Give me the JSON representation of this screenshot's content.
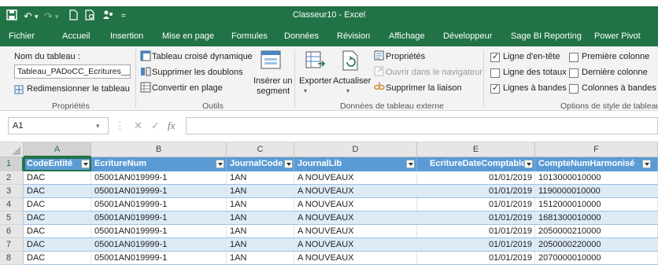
{
  "titlebar": {
    "title": "Classeur10 - Excel"
  },
  "tabs": [
    {
      "label": "Fichier"
    },
    {
      "label": "Accueil"
    },
    {
      "label": "Insertion"
    },
    {
      "label": "Mise en page"
    },
    {
      "label": "Formules"
    },
    {
      "label": "Données"
    },
    {
      "label": "Révision"
    },
    {
      "label": "Affichage"
    },
    {
      "label": "Développeur"
    },
    {
      "label": "Sage BI Reporting"
    },
    {
      "label": "Power Pivot"
    }
  ],
  "ribbon": {
    "proprietes": {
      "nom_label": "Nom du tableau :",
      "nom_value": "Tableau_PADoCC_Ecritures__B",
      "resize": "Redimensionner le tableau",
      "group": "Propriétés"
    },
    "outils": {
      "pivot": "Tableau croisé dynamique",
      "dedupe": "Supprimer les doublons",
      "convert": "Convertir en plage",
      "slicer_1": "Insérer un",
      "slicer_2": "segment",
      "group": "Outils"
    },
    "externe": {
      "export": "Exporter",
      "refresh": "Actualiser",
      "props": "Propriétés",
      "open_nav": "Ouvrir dans le navigateur",
      "unlink": "Supprimer la liaison",
      "group": "Données de tableau externe"
    },
    "options": {
      "header_row": "Ligne d'en-tête",
      "totals_row": "Ligne des totaux",
      "banded_rows": "Lignes à bandes",
      "first_col": "Première colonne",
      "last_col": "Dernière colonne",
      "banded_cols": "Colonnes à bandes",
      "group": "Options de style de tableau",
      "header_row_checked": true,
      "totals_row_checked": false,
      "banded_rows_checked": true,
      "first_col_checked": false,
      "last_col_checked": false,
      "banded_cols_checked": false
    }
  },
  "formula_bar": {
    "name_box": "A1",
    "fx": "fx",
    "content": ""
  },
  "columns": [
    "A",
    "B",
    "C",
    "D",
    "E",
    "F"
  ],
  "table_headers": [
    "CodeEntité",
    "EcritureNum",
    "JournalCode",
    "JournalLib",
    "EcritureDateComptable",
    "CompteNumHarmonisé"
  ],
  "rows": [
    {
      "n": "2",
      "cells": [
        "DAC",
        "05001AN019999-1",
        "1AN",
        "A NOUVEAUX",
        "01/01/2019",
        "1013000010000"
      ]
    },
    {
      "n": "3",
      "cells": [
        "DAC",
        "05001AN019999-1",
        "1AN",
        "A NOUVEAUX",
        "01/01/2019",
        "1190000010000"
      ]
    },
    {
      "n": "4",
      "cells": [
        "DAC",
        "05001AN019999-1",
        "1AN",
        "A NOUVEAUX",
        "01/01/2019",
        "1512000010000"
      ]
    },
    {
      "n": "5",
      "cells": [
        "DAC",
        "05001AN019999-1",
        "1AN",
        "A NOUVEAUX",
        "01/01/2019",
        "1681300010000"
      ]
    },
    {
      "n": "6",
      "cells": [
        "DAC",
        "05001AN019999-1",
        "1AN",
        "A NOUVEAUX",
        "01/01/2019",
        "2050000210000"
      ]
    },
    {
      "n": "7",
      "cells": [
        "DAC",
        "05001AN019999-1",
        "1AN",
        "A NOUVEAUX",
        "01/01/2019",
        "2050000220000"
      ]
    },
    {
      "n": "8",
      "cells": [
        "DAC",
        "05001AN019999-1",
        "1AN",
        "A NOUVEAUX",
        "01/01/2019",
        "2070000010000"
      ]
    }
  ],
  "header_row_number": "1",
  "colors": {
    "excel_green": "#217346",
    "table_header": "#5b9bd5",
    "band": "#ddebf7"
  }
}
